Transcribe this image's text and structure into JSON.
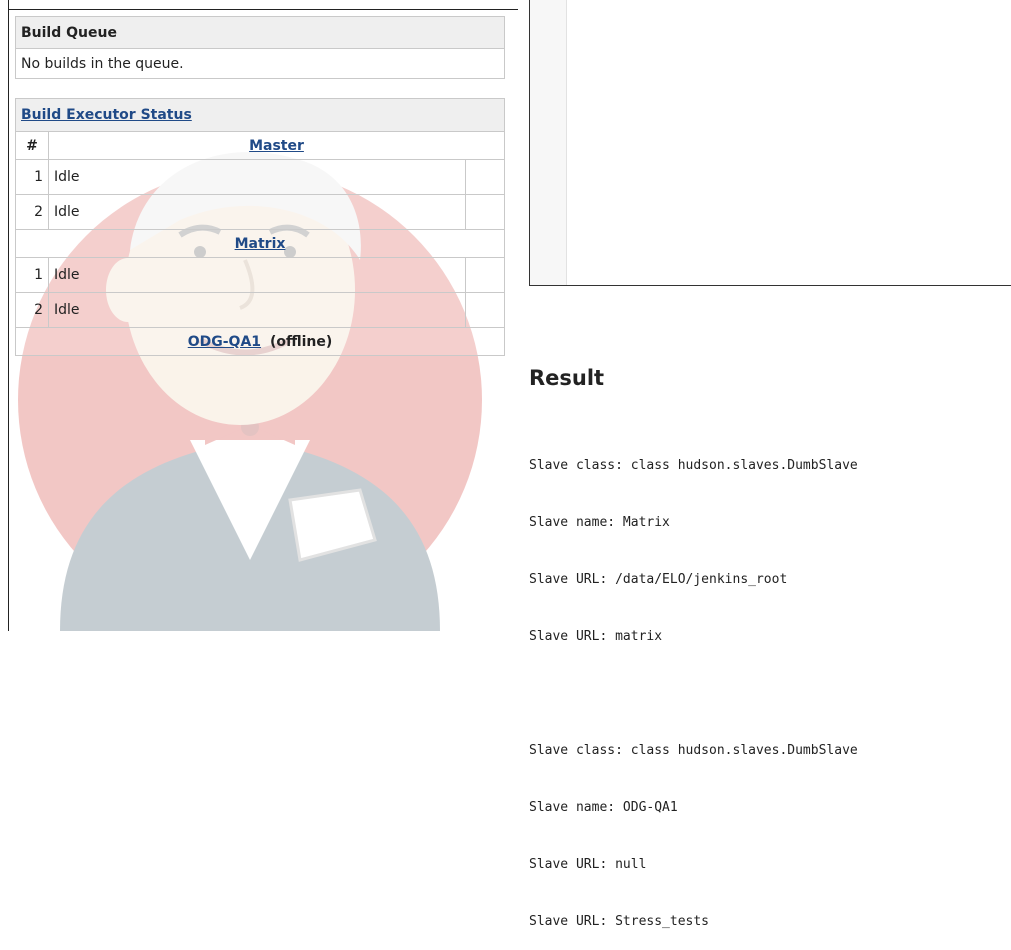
{
  "build_queue": {
    "title": "Build Queue",
    "empty_message": "No builds in the queue."
  },
  "executor_status": {
    "title": "Build Executor Status",
    "number_header": "#",
    "computers": [
      {
        "name": "Master",
        "status": "",
        "executors": [
          {
            "number": "1",
            "state": "Idle"
          },
          {
            "number": "2",
            "state": "Idle"
          }
        ]
      },
      {
        "name": "Matrix",
        "status": "",
        "executors": [
          {
            "number": "1",
            "state": "Idle"
          },
          {
            "number": "2",
            "state": "Idle"
          }
        ]
      },
      {
        "name": "ODG-QA1",
        "status": "(offline)",
        "executors": []
      }
    ]
  },
  "result": {
    "title": "Result",
    "lines": [
      "Slave class: class hudson.slaves.DumbSlave",
      "Slave name: Matrix",
      "Slave URL: /data/ELO/jenkins_root",
      "Slave URL: matrix",
      "",
      "Slave class: class hudson.slaves.DumbSlave",
      "Slave name: ODG-QA1",
      "Slave URL: null",
      "Slave URL: Stress_tests"
    ]
  },
  "colors": {
    "link": "#204a87",
    "header_bg": "#eeeeee",
    "border": "#c9c9c9",
    "watermark_red": "#d33833"
  },
  "icons": {
    "watermark": "jenkins-butler-icon"
  }
}
